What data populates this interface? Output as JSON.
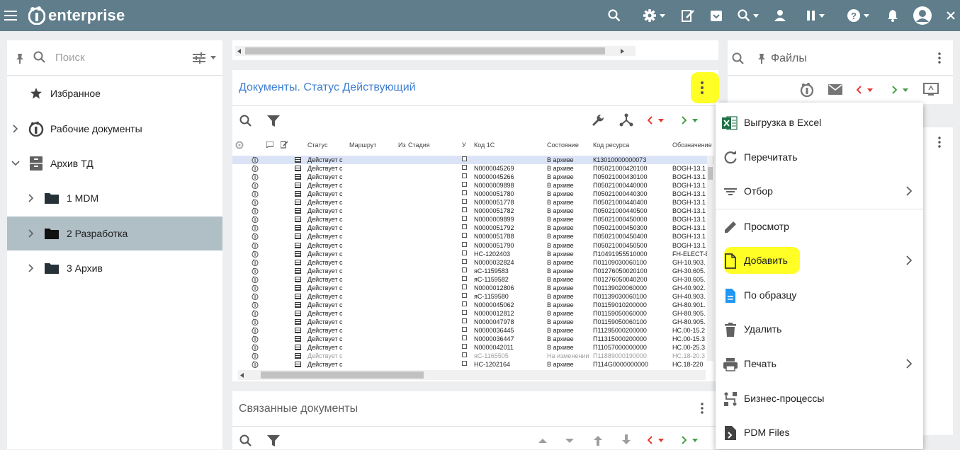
{
  "app": {
    "brand": "enterprise"
  },
  "left": {
    "search_placeholder": "Поиск",
    "tree": [
      {
        "label": "Избранное",
        "icon": "star-icon"
      },
      {
        "label": "Рабочие документы",
        "icon": "logo-icon"
      },
      {
        "label": "Архив ТД",
        "icon": "archive-icon"
      },
      {
        "label": "1 MDM",
        "icon": "folder-icon"
      },
      {
        "label": "2 Разработка",
        "icon": "folder-icon",
        "selected": true
      },
      {
        "label": "3 Архив",
        "icon": "folder-icon"
      }
    ]
  },
  "docs": {
    "title": "Документы. Статус Действующий",
    "columns": {
      "status": "Статус",
      "route": "Маршрут",
      "from_stage": "Из",
      "stage": "Стадия",
      "u": "У",
      "code1c": "Код 1С",
      "state": "Состояние",
      "res_code": "Код ресурса",
      "designation": "Обозначение"
    },
    "rows": [
      {
        "status": "Действует с",
        "code": "",
        "state": "В архиве",
        "res": "К13010000000073",
        "des": "",
        "first": true
      },
      {
        "status": "Действует с",
        "code": "N0000045269",
        "state": "В архиве",
        "res": "П05021000420100",
        "des": "BOGH-13.1"
      },
      {
        "status": "Действует с",
        "code": "N0000045266",
        "state": "В архиве",
        "res": "П05021000430100",
        "des": "BOGH-13.1"
      },
      {
        "status": "Действует с",
        "code": "N0000009898",
        "state": "В архиве",
        "res": "П05021000440000",
        "des": "BOGH-13.1"
      },
      {
        "status": "Действует с",
        "code": "N0000051780",
        "state": "В архиве",
        "res": "П05021000440300",
        "des": "BOGH-13.1"
      },
      {
        "status": "Действует с",
        "code": "N0000051778",
        "state": "В архиве",
        "res": "П05021000440400",
        "des": "BOGH-13.1"
      },
      {
        "status": "Действует с",
        "code": "N0000051782",
        "state": "В архиве",
        "res": "П05021000440500",
        "des": "BOGH-13.1"
      },
      {
        "status": "Действует с",
        "code": "N0000009899",
        "state": "В архиве",
        "res": "П05021000450000",
        "des": "BOGH-13.1"
      },
      {
        "status": "Действует с",
        "code": "N0000051792",
        "state": "В архиве",
        "res": "П05021000450300",
        "des": "BOGH-13.1"
      },
      {
        "status": "Действует с",
        "code": "N0000051788",
        "state": "В архиве",
        "res": "П05021000450400",
        "des": "BOGH-13.1"
      },
      {
        "status": "Действует с",
        "code": "N0000051790",
        "state": "В архиве",
        "res": "П05021000450500",
        "des": "BOGH-13.1"
      },
      {
        "status": "Действует с",
        "code": "НС-1202403",
        "state": "В архиве",
        "res": "П10491955510000",
        "des": "FH-ELECT-E"
      },
      {
        "status": "Действует с",
        "code": "N0000032824",
        "state": "В архиве",
        "res": "П01109030060100",
        "des": "GH-10.903."
      },
      {
        "status": "Действует с",
        "code": "яС-1159583",
        "state": "В архиве",
        "res": "П01276050020100",
        "des": "GH-30.605."
      },
      {
        "status": "Действует с",
        "code": "яС-1159582",
        "state": "В архиве",
        "res": "П01276050040200",
        "des": "GH-30.605."
      },
      {
        "status": "Действует с",
        "code": "N0000012806",
        "state": "В архиве",
        "res": "П01139020060000",
        "des": "GH-40.902."
      },
      {
        "status": "Действует с",
        "code": "яС-1159580",
        "state": "В архиве",
        "res": "П01139030060100",
        "des": "GH-40.903."
      },
      {
        "status": "Действует с",
        "code": "N0000045062",
        "state": "В архиве",
        "res": "П01159010200000",
        "des": "GH-80.901."
      },
      {
        "status": "Действует с",
        "code": "N0000012812",
        "state": "В архиве",
        "res": "П01159050060000",
        "des": "GH-80.905."
      },
      {
        "status": "Действует с",
        "code": "N0000047978",
        "state": "В архиве",
        "res": "П01159050060100",
        "des": "GH-80.905."
      },
      {
        "status": "Действует с",
        "code": "N0000036445",
        "state": "В архиве",
        "res": "П11295000200000",
        "des": "HC.00-15.2"
      },
      {
        "status": "Действует с",
        "code": "N0000036447",
        "state": "В архиве",
        "res": "П11315000200000",
        "des": "HC.00-15.3"
      },
      {
        "status": "Действует с",
        "code": "N0000042011",
        "state": "В архиве",
        "res": "П11057000000000",
        "des": "HC.00-25.3"
      },
      {
        "status": "Действует с",
        "code": "яС-1165505",
        "state": "На изменении",
        "res": "П11889000190000",
        "des": "HC.18-20.3",
        "gray": true
      },
      {
        "status": "Действует с",
        "code": "НС-1202164",
        "state": "В архиве",
        "res": "П114G0000000000",
        "des": "HC.18-220"
      }
    ]
  },
  "related": {
    "title": "Связанные документы"
  },
  "right": {
    "files_title": "Файлы"
  },
  "menu": {
    "items": [
      {
        "label": "Выгрузка в Excel",
        "icon": "excel-icon"
      },
      {
        "label": "Перечитать",
        "icon": "refresh-icon"
      },
      {
        "label": "Отбор",
        "icon": "filter-list-icon",
        "submenu": true
      },
      {
        "label": "Просмотр",
        "icon": "pencil-icon"
      },
      {
        "label": "Добавить",
        "icon": "new-document-icon",
        "submenu": true
      },
      {
        "label": "По образцу",
        "icon": "document-copy-icon"
      },
      {
        "label": "Удалить",
        "icon": "trash-icon"
      },
      {
        "label": "Печать",
        "icon": "printer-icon",
        "submenu": true
      },
      {
        "label": "Бизнес-процессы",
        "icon": "workflow-icon"
      },
      {
        "label": "PDM Files",
        "icon": "pdm-files-icon"
      }
    ]
  },
  "colors": {
    "topbar": "#607d8b",
    "accent": "#3f7fd0",
    "selected": "#b0bec5",
    "highlight": "#ffff00",
    "red_arrow": "#e53935",
    "green_arrow": "#43a047"
  }
}
